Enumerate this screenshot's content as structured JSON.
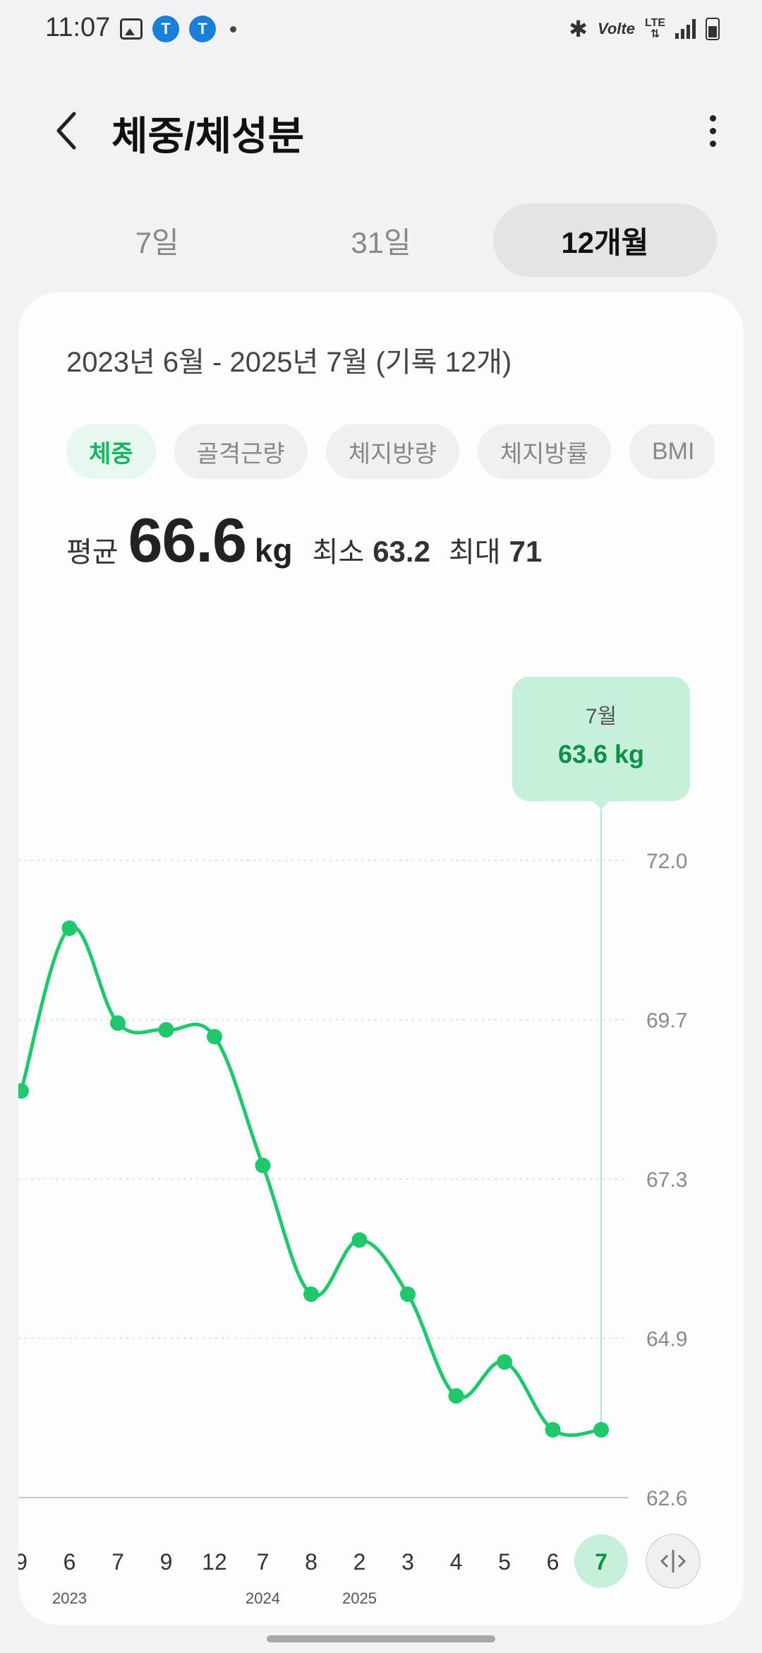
{
  "status": {
    "time": "11:07",
    "app_icon_label": "T",
    "volte": "Volte",
    "lte": "LTE"
  },
  "header": {
    "title": "체중/체성분"
  },
  "tabs": [
    {
      "label": "7일",
      "active": false
    },
    {
      "label": "31일",
      "active": false
    },
    {
      "label": "12개월",
      "active": true
    }
  ],
  "card": {
    "range_text": "2023년 6월 - 2025년 7월 (기록 12개)",
    "chips": [
      {
        "label": "체중",
        "active": true
      },
      {
        "label": "골격근량",
        "active": false
      },
      {
        "label": "체지방량",
        "active": false
      },
      {
        "label": "체지방률",
        "active": false
      },
      {
        "label": "BMI",
        "active": false
      }
    ],
    "summary": {
      "avg_label": "평균",
      "avg_value": "66.6",
      "unit": "kg",
      "min_label": "최소",
      "min_value": "63.2",
      "max_label": "최대",
      "max_value": "71"
    }
  },
  "chart_data": {
    "type": "line",
    "title": "",
    "xlabel": "",
    "ylabel": "",
    "y_ticks": [
      "72.0",
      "69.7",
      "67.3",
      "64.9",
      "62.6"
    ],
    "ylim": [
      62.6,
      72.0
    ],
    "x_tick_labels": [
      "9",
      "6",
      "7",
      "9",
      "12",
      "7",
      "8",
      "2",
      "3",
      "4",
      "5",
      "6",
      "7"
    ],
    "year_labels": [
      {
        "index": 1,
        "label": "2023"
      },
      {
        "index": 5,
        "label": "2024"
      },
      {
        "index": 7,
        "label": "2025"
      }
    ],
    "values": [
      68.6,
      71.0,
      69.6,
      69.5,
      69.4,
      67.5,
      65.6,
      66.4,
      65.6,
      64.1,
      64.6,
      63.6,
      63.6
    ],
    "selected_index": 12,
    "tooltip": {
      "month": "7월",
      "value": "63.6 kg"
    },
    "line_color": "#1fc86d",
    "highlight_color": "#c6f0da",
    "grid": true
  }
}
